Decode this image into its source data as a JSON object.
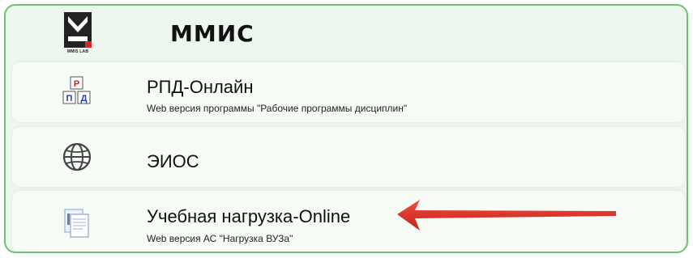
{
  "header": {
    "logo_caption": "MMIS LAB",
    "brand": "ММИС"
  },
  "items": [
    {
      "title": "РПД-Онлайн",
      "subtitle": "Web версия программы \"Рабочие программы дисциплин\"",
      "icon": "rpd-blocks-icon",
      "icon_letters": [
        "Р",
        "П",
        "Д"
      ]
    },
    {
      "title": "ЭИОС",
      "subtitle": "",
      "icon": "globe-icon"
    },
    {
      "title": "Учебная нагрузка-Online",
      "subtitle": "Web версия АС \"Нагрузка ВУЗа\"",
      "icon": "documents-icon"
    }
  ],
  "colors": {
    "border": "#6cc36c",
    "panel_bg": "#eef7ee",
    "card_bg": "#f6fbf6",
    "logo_red": "#d9272e",
    "arrow_red": "#e0322b"
  },
  "annotation": {
    "arrow": "red-arrow-pointing-left"
  }
}
